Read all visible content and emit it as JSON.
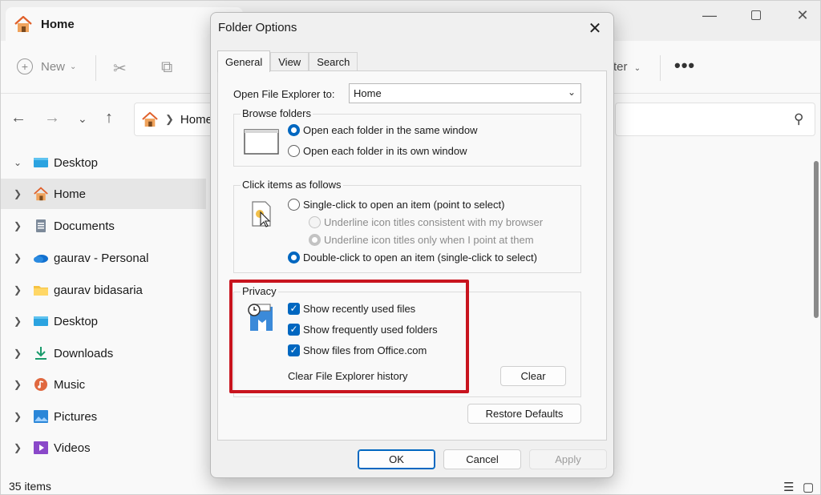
{
  "explorer": {
    "tab_title": "Home",
    "window_controls": [
      "minimize-icon",
      "maximize-icon",
      "close-icon"
    ],
    "commandbar": {
      "new_label": "New",
      "filter_label_fragment": "ter",
      "more_label": "•••"
    },
    "address": {
      "breadcrumb": "Home"
    },
    "sidebar": {
      "items": [
        {
          "label": "Desktop",
          "icon": "desktop-icon",
          "expanded": true
        },
        {
          "label": "Home",
          "icon": "home-icon",
          "selected": true
        },
        {
          "label": "Documents",
          "icon": "documents-icon"
        },
        {
          "label": "gaurav - Personal",
          "icon": "onedrive-icon"
        },
        {
          "label": "gaurav bidasaria",
          "icon": "folder-icon"
        },
        {
          "label": "Desktop",
          "icon": "desktop-icon"
        },
        {
          "label": "Downloads",
          "icon": "downloads-icon"
        },
        {
          "label": "Music",
          "icon": "music-icon"
        },
        {
          "label": "Pictures",
          "icon": "pictures-icon"
        },
        {
          "label": "Videos",
          "icon": "videos-icon"
        }
      ]
    },
    "status": {
      "items_count": "35 items"
    },
    "colors": {
      "accent": "#0067c0",
      "highlight": "#c8141e"
    }
  },
  "dialog": {
    "title": "Folder Options",
    "tabs": [
      {
        "label": "General",
        "active": true
      },
      {
        "label": "View",
        "active": false
      },
      {
        "label": "Search",
        "active": false
      }
    ],
    "open_to": {
      "label": "Open File Explorer to:",
      "value": "Home"
    },
    "browse": {
      "title": "Browse folders",
      "options": [
        {
          "label": "Open each folder in the same window",
          "selected": true
        },
        {
          "label": "Open each folder in its own window",
          "selected": false
        }
      ]
    },
    "click": {
      "title": "Click items as follows",
      "single": {
        "label": "Single-click to open an item (point to select)",
        "selected": false
      },
      "underline_browser": {
        "label": "Underline icon titles consistent with my browser",
        "selected": false,
        "disabled": true
      },
      "underline_point": {
        "label": "Underline icon titles only when I point at them",
        "selected": true,
        "disabled": true
      },
      "double": {
        "label": "Double-click to open an item (single-click to select)",
        "selected": true
      }
    },
    "privacy": {
      "title": "Privacy",
      "checks": [
        {
          "label": "Show recently used files",
          "checked": true
        },
        {
          "label": "Show frequently used folders",
          "checked": true
        },
        {
          "label": "Show files from Office.com",
          "checked": true
        }
      ],
      "clear_label": "Clear File Explorer history",
      "clear_button": "Clear"
    },
    "restore_button": "Restore Defaults",
    "ok_button": "OK",
    "cancel_button": "Cancel",
    "apply_button": "Apply"
  }
}
